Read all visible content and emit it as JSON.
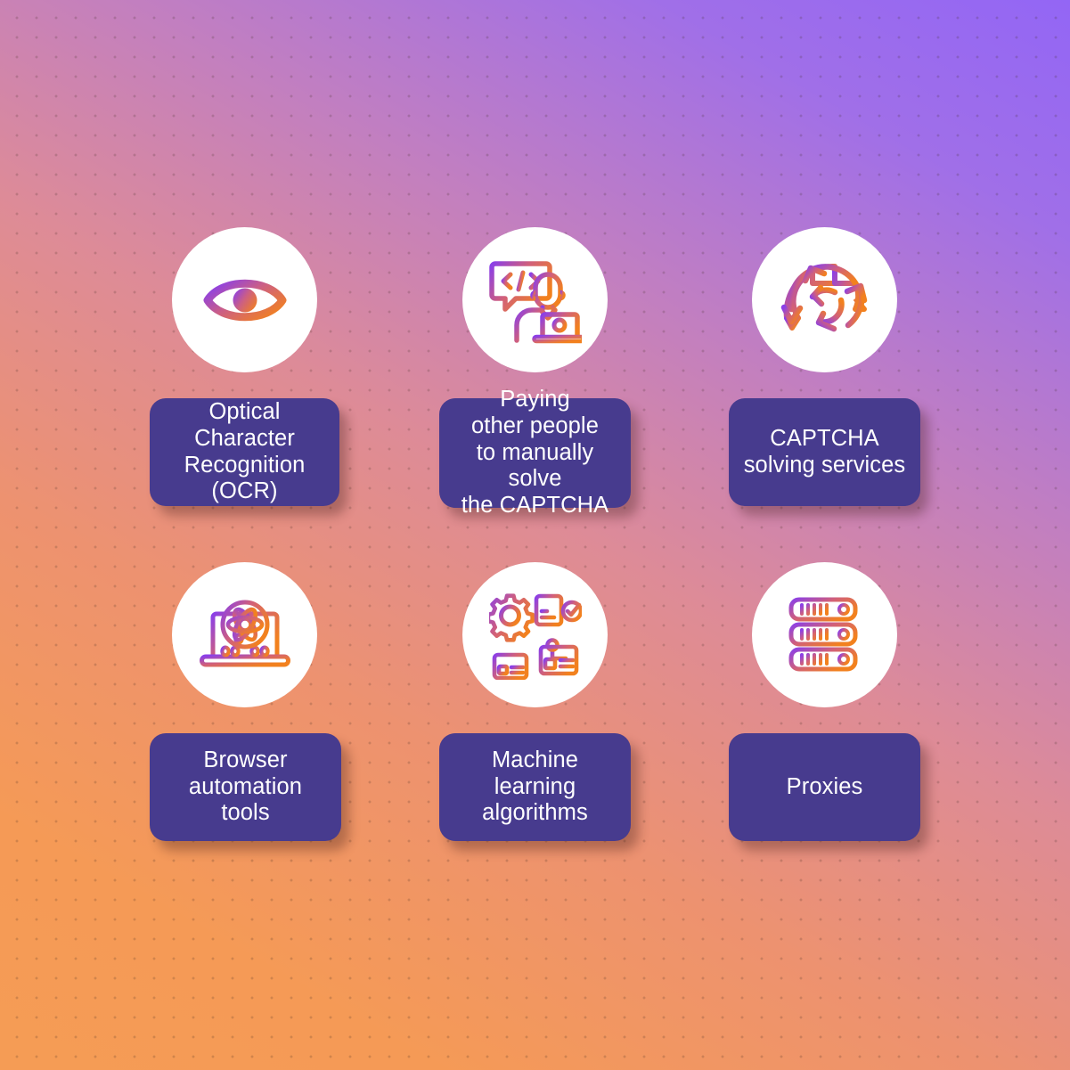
{
  "background": {
    "gradient_from": "#9366f5",
    "gradient_mid": "#dd8b98",
    "gradient_to": "#f59a56",
    "dot_color": "rgba(60,40,30,0.20)"
  },
  "theme": {
    "card_color": "#473b8e",
    "card_text_color": "#ffffff",
    "circle_color": "#ffffff",
    "icon_gradient_start": "#8b3fe8",
    "icon_gradient_mid": "#d1607a",
    "icon_gradient_end": "#f2811e"
  },
  "items": [
    {
      "id": "ocr",
      "icon": "eye-icon",
      "label": "Optical\nCharacter\nRecognition\n(OCR)"
    },
    {
      "id": "paying-people",
      "icon": "developer-chat-code-icon",
      "label": "Paying\nother people\nto manually solve\nthe CAPTCHA"
    },
    {
      "id": "captcha-solving-services",
      "icon": "refresh-cycle-arrows-icon",
      "label": "CAPTCHA\nsolving services"
    },
    {
      "id": "browser-automation",
      "icon": "laptop-atom-binary-icon",
      "label": "Browser\nautomation tools"
    },
    {
      "id": "machine-learning",
      "icon": "workflow-gear-nodes-icon",
      "label": "Machine learning\nalgorithms"
    },
    {
      "id": "proxies",
      "icon": "server-rack-icon",
      "label": "Proxies"
    }
  ]
}
